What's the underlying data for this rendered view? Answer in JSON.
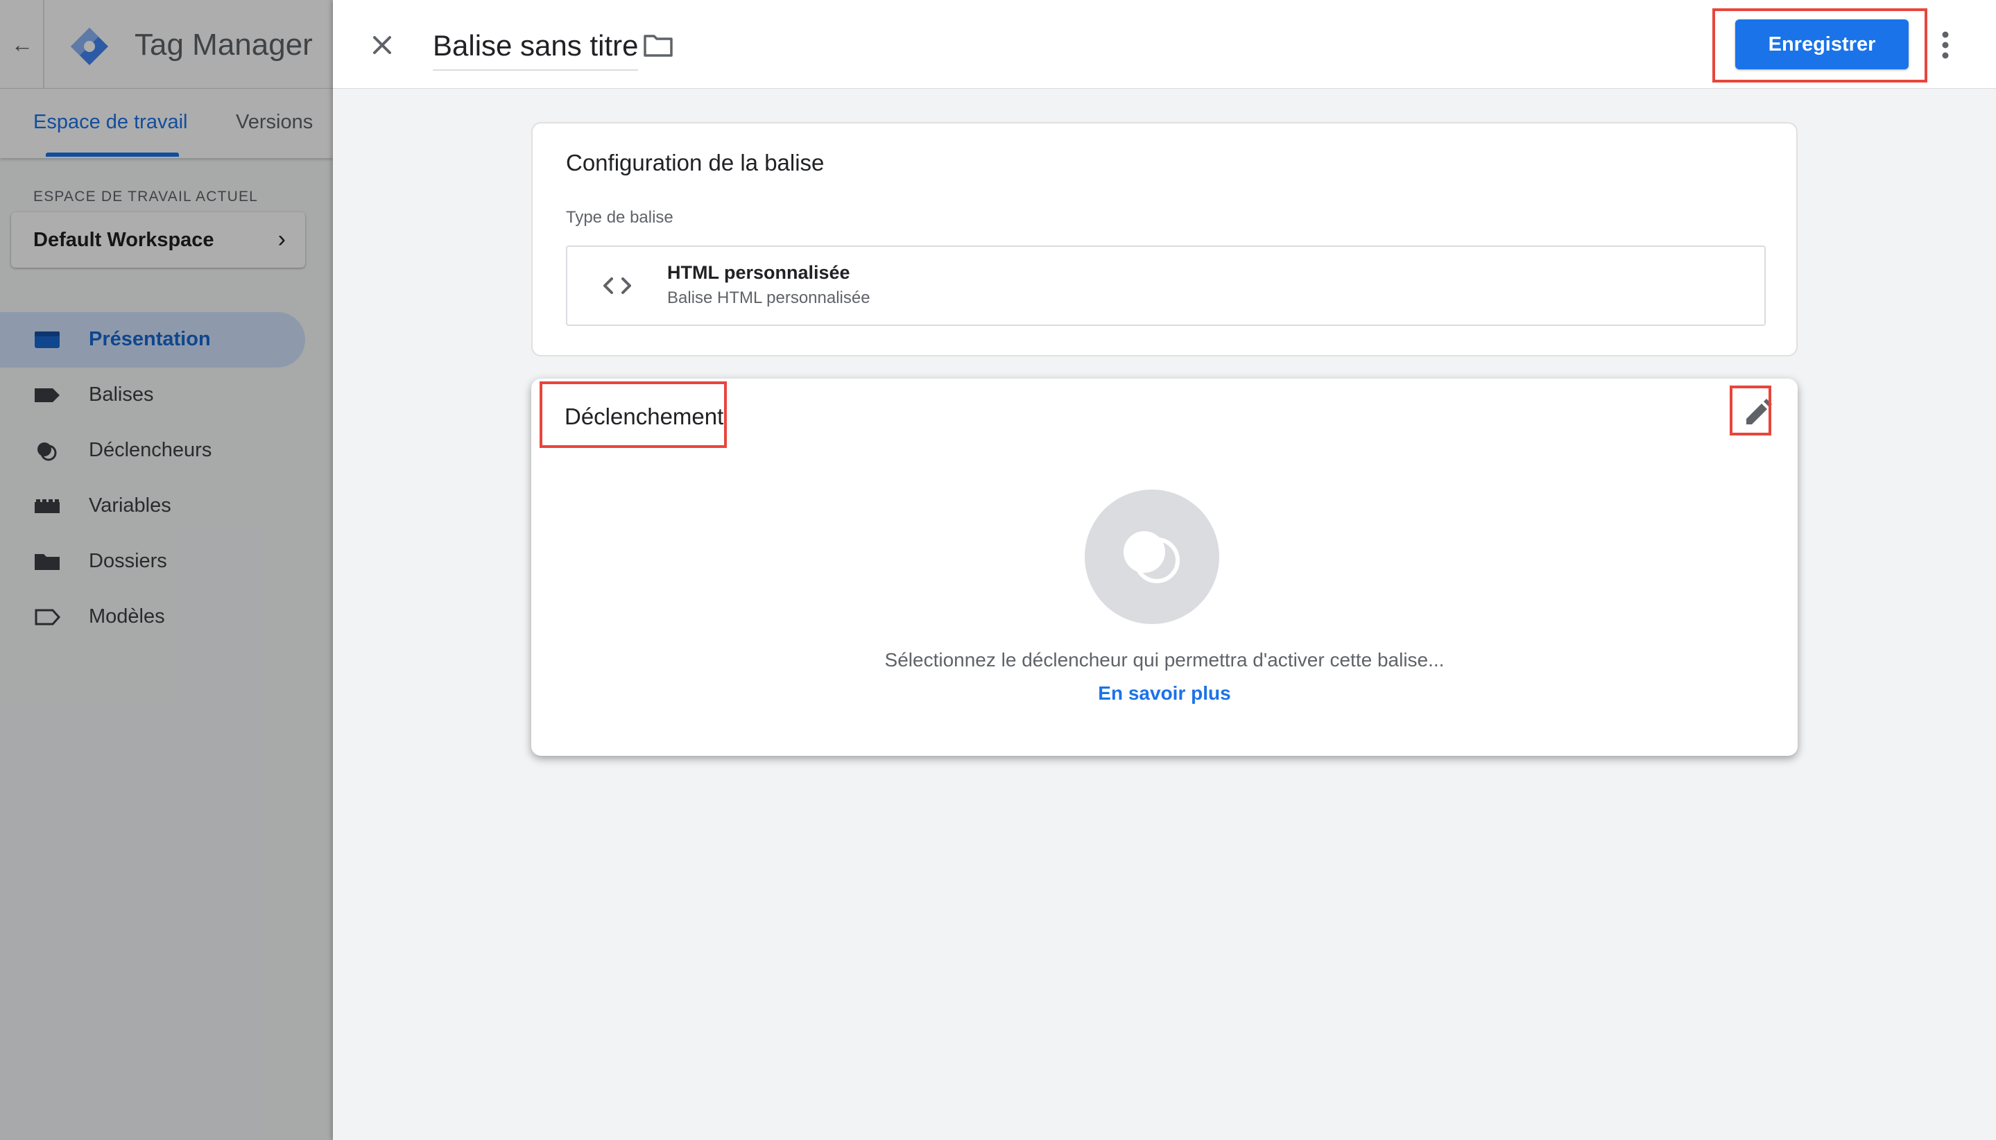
{
  "app": {
    "title": "Tag Manager",
    "tabs": [
      {
        "label": "Espace de travail",
        "active": true
      },
      {
        "label": "Versions",
        "active": false
      }
    ],
    "workspace_label": "ESPACE DE TRAVAIL ACTUEL",
    "workspace_name": "Default Workspace",
    "nav": [
      {
        "label": "Présentation",
        "icon": "overview-icon",
        "active": true
      },
      {
        "label": "Balises",
        "icon": "tag-icon",
        "active": false
      },
      {
        "label": "Déclencheurs",
        "icon": "trigger-icon",
        "active": false
      },
      {
        "label": "Variables",
        "icon": "variables-icon",
        "active": false
      },
      {
        "label": "Dossiers",
        "icon": "folder-icon",
        "active": false
      },
      {
        "label": "Modèles",
        "icon": "templates-icon",
        "active": false
      }
    ]
  },
  "editor": {
    "title": "Balise sans titre",
    "save_label": "Enregistrer",
    "config": {
      "title": "Configuration de la balise",
      "type_label": "Type de balise",
      "type_name": "HTML personnalisée",
      "type_desc": "Balise HTML personnalisée"
    },
    "trigger": {
      "title": "Déclenchement",
      "empty_text": "Sélectionnez le déclencheur qui permettra d'activer cette balise...",
      "link": "En savoir plus"
    }
  },
  "colors": {
    "accent": "#1a73e8",
    "highlight": "#e8453c",
    "nav_active_bg": "#d2e3fc"
  }
}
